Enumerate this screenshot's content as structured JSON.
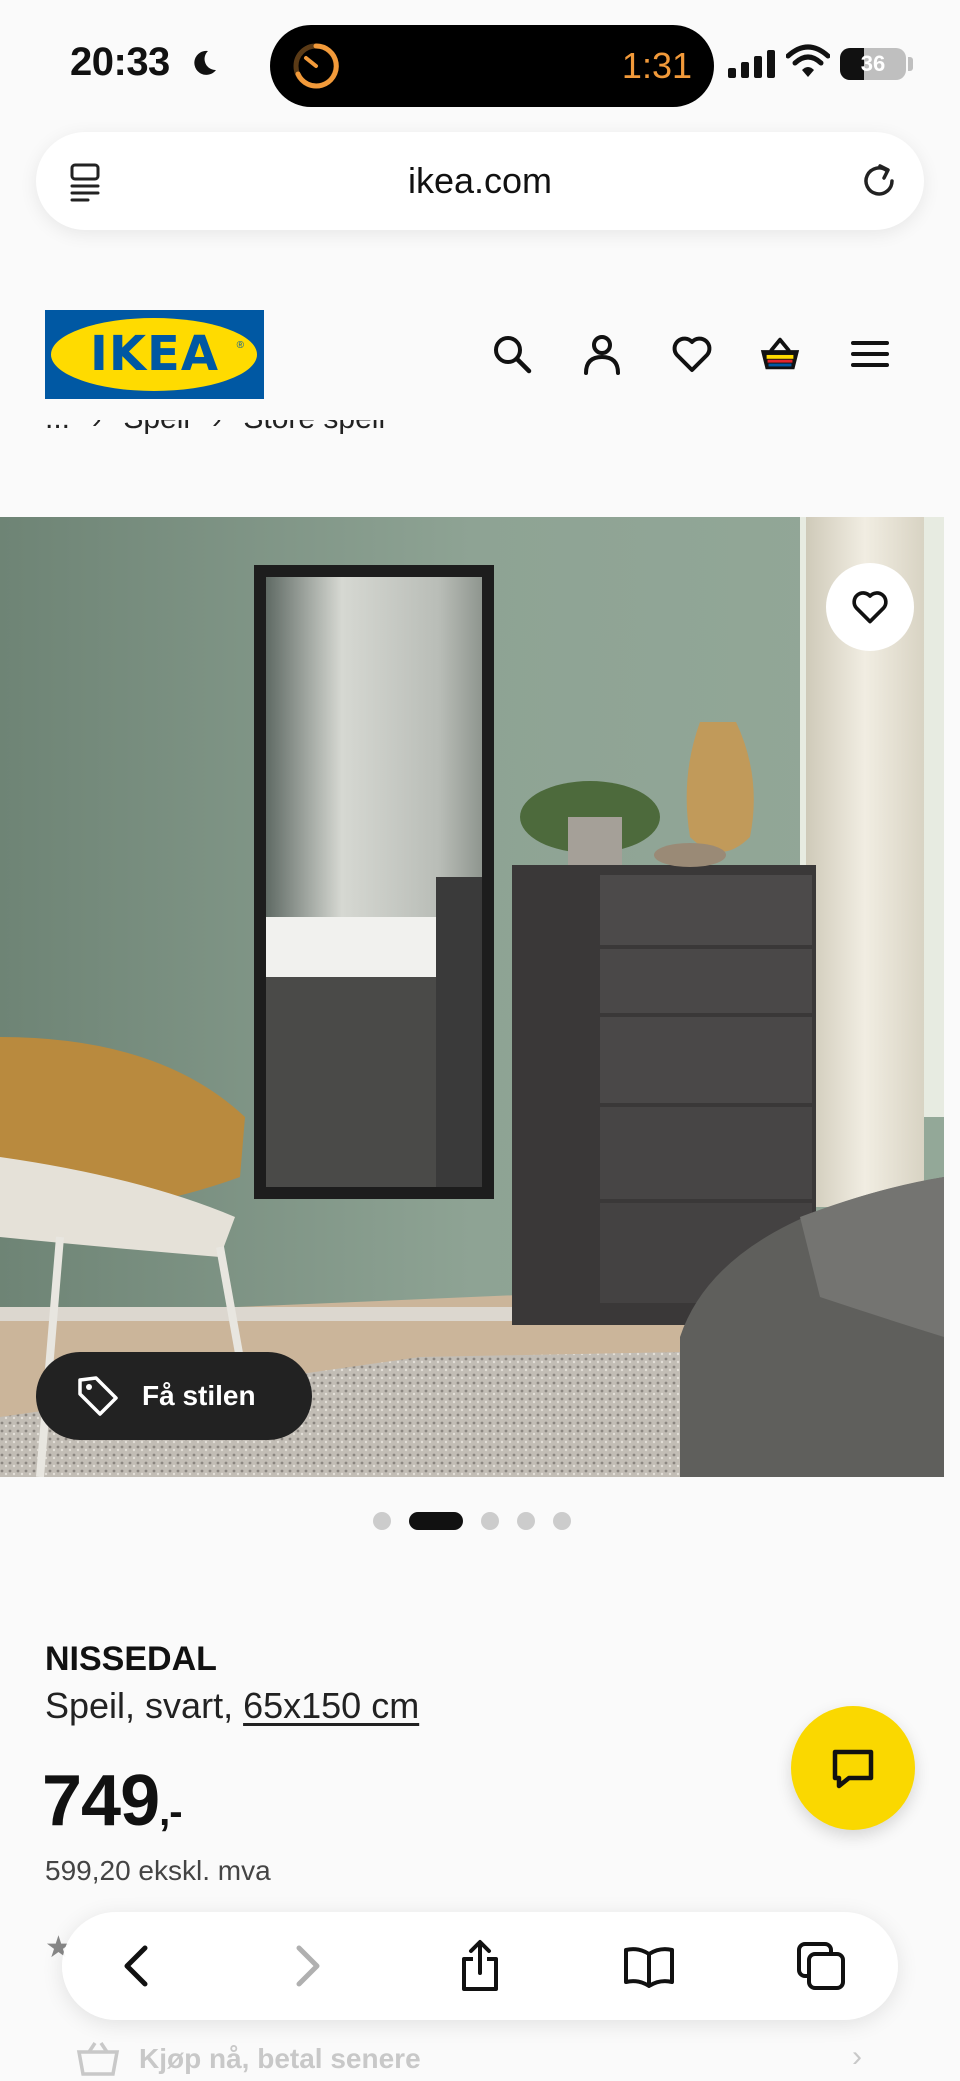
{
  "status_bar": {
    "time": "20:33",
    "activity_time": "1:31",
    "battery": "36",
    "battery_level": 0.36,
    "activity_color": "#f29a3a"
  },
  "browser": {
    "url": "ikea.com"
  },
  "site": {
    "logo_text": "IKEA",
    "brand_blue": "#0058a3",
    "brand_yellow": "#ffdb00",
    "header_icons": [
      "search-icon",
      "profile-icon",
      "heart-icon",
      "cart-icon",
      "menu-icon"
    ]
  },
  "breadcrumb": {
    "items": [
      "...",
      "Speil",
      "Store speil"
    ]
  },
  "gallery": {
    "style_button_label": "Få stilen",
    "slide_count": 5,
    "active_slide": 2
  },
  "product": {
    "name": "NISSEDAL",
    "description": "Speil, svart, ",
    "size_link": "65x150 cm",
    "price": "749",
    "price_suffix": ",-",
    "price_excl_vat": "599,20 ekskl. mva"
  },
  "payment": {
    "pay_later_label": "Kjøp nå, betal senere"
  },
  "toolbar": {
    "buttons": [
      "back-icon",
      "forward-icon",
      "share-icon",
      "bookmarks-icon",
      "tabs-icon"
    ]
  }
}
